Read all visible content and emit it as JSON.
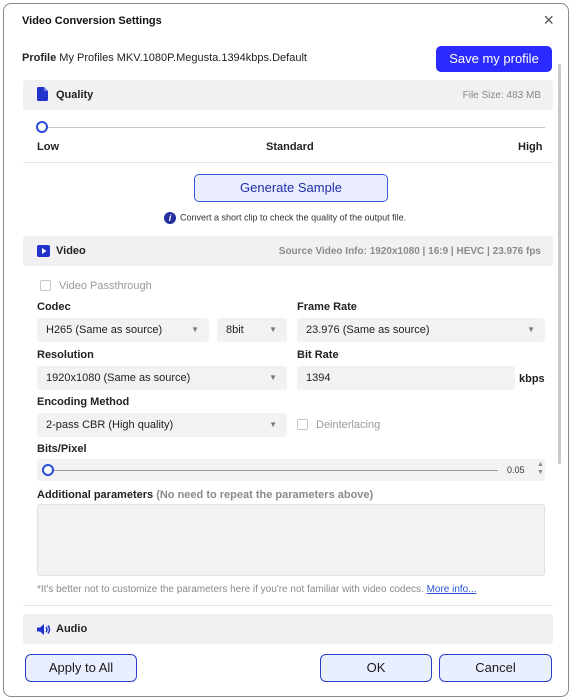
{
  "dialog": {
    "title": "Video Conversion Settings",
    "close_glyph": "×"
  },
  "profile": {
    "label": "Profile",
    "value": "My Profiles MKV.1080P.Megusta.1394kbps.Default",
    "save_label": "Save my profile"
  },
  "quality": {
    "title": "Quality",
    "file_size": "File Size:  483 MB",
    "slider_value": 0,
    "low": "Low",
    "standard": "Standard",
    "high": "High",
    "generate_label": "Generate Sample",
    "hint": "Convert a short clip to check the quality of the output file."
  },
  "video": {
    "title": "Video",
    "source_info": "Source Video Info: 1920x1080 | 16:9 | HEVC | 23.976 fps",
    "passthrough_label": "Video Passthrough",
    "codec_label": "Codec",
    "codec_value": "H265 (Same as source)",
    "bitdepth_value": "8bit",
    "framerate_label": "Frame Rate",
    "framerate_value": "23.976 (Same as source)",
    "resolution_label": "Resolution",
    "resolution_value": "1920x1080 (Same as source)",
    "bitrate_label": "Bit Rate",
    "bitrate_value": "1394",
    "bitrate_unit": "kbps",
    "encoding_label": "Encoding Method",
    "encoding_value": "2-pass CBR (High quality)",
    "deinterlacing_label": "Deinterlacing",
    "bpp_label": "Bits/Pixel",
    "bpp_value": "0.05",
    "additional_label": "Additional parameters",
    "additional_sub": "(No need to repeat the parameters above)",
    "note": "*It's better not to customize the parameters here if you're not familiar with video codecs.",
    "more_info": "More info..."
  },
  "audio": {
    "title": "Audio"
  },
  "footer": {
    "apply_all": "Apply to All",
    "ok": "OK",
    "cancel": "Cancel"
  },
  "colors": {
    "accent": "#2b2bff",
    "button_border": "#2b3fcc",
    "section_bg": "#f1f1f3"
  }
}
